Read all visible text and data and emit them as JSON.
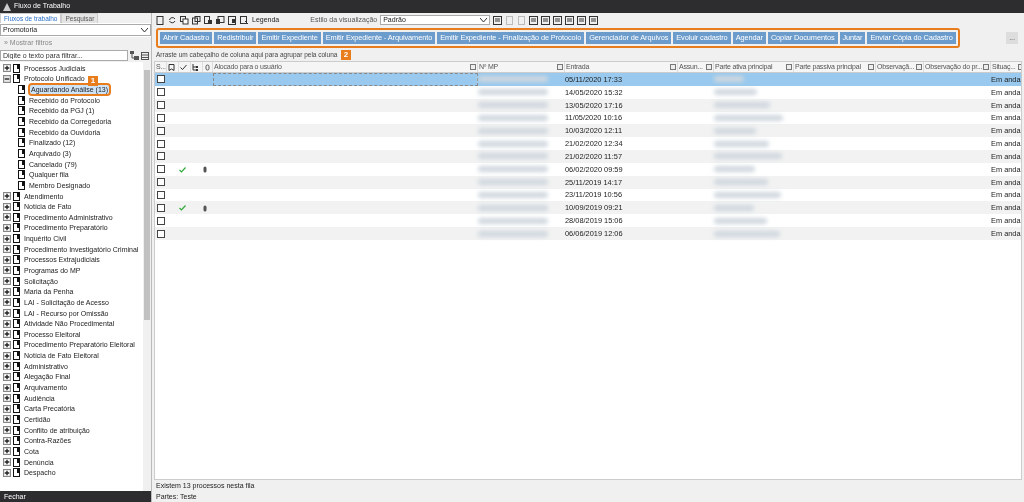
{
  "window": {
    "title": "Fluxo de Trabalho"
  },
  "left_tabs": [
    {
      "label": "Fluxos de trabalho",
      "selected": true
    },
    {
      "label": "Pesquisar",
      "selected": false
    }
  ],
  "scope_select": {
    "value": "Promotoria"
  },
  "filters_toggle": {
    "label": "Mostrar filtros",
    "arrow": "»"
  },
  "filter_field": {
    "placeholder": "Digite o texto para filtrar..."
  },
  "tree": [
    {
      "label": "Processos Judiciais",
      "expanded": false,
      "selected": false
    },
    {
      "label": "Protocolo Unificado",
      "expanded": true,
      "selected": false,
      "children": [
        {
          "label": "Aguardando Análise (13)",
          "selected": true,
          "callout": "1"
        },
        {
          "label": "Recebido do Protocolo",
          "selected": false
        },
        {
          "label": "Recebido da PGJ (1)",
          "selected": false
        },
        {
          "label": "Recebido da Corregedoria",
          "selected": false
        },
        {
          "label": "Recebido da Ouvidoria",
          "selected": false
        },
        {
          "label": "Finalizado (12)",
          "selected": false
        },
        {
          "label": "Arquivado (3)",
          "selected": false
        },
        {
          "label": "Cancelado (79)",
          "selected": false
        },
        {
          "label": "Qualquer fila",
          "selected": false
        },
        {
          "label": "Membro Designado",
          "selected": false
        }
      ]
    },
    {
      "label": "Atendimento",
      "expanded": false,
      "selected": false
    },
    {
      "label": "Notícia de Fato",
      "expanded": false,
      "selected": false
    },
    {
      "label": "Procedimento Administrativo",
      "expanded": false,
      "selected": false
    },
    {
      "label": "Procedimento Preparatório",
      "expanded": false,
      "selected": false
    },
    {
      "label": "Inquérito Civil",
      "expanded": false,
      "selected": false
    },
    {
      "label": "Procedimento Investigatório Criminal",
      "expanded": false,
      "selected": false
    },
    {
      "label": "Processos Extrajudiciais",
      "expanded": false,
      "selected": false
    },
    {
      "label": "Programas do MP",
      "expanded": false,
      "selected": false
    },
    {
      "label": "Solicitação",
      "expanded": false,
      "selected": false
    },
    {
      "label": "Maria da Penha",
      "expanded": false,
      "selected": false
    },
    {
      "label": "LAI - Solicitação de Acesso",
      "expanded": false,
      "selected": false
    },
    {
      "label": "LAI - Recurso por Omissão",
      "expanded": false,
      "selected": false
    },
    {
      "label": "Atividade Não Procedimental",
      "expanded": false,
      "selected": false
    },
    {
      "label": "Processo Eleitoral",
      "expanded": false,
      "selected": false
    },
    {
      "label": "Procedimento Preparatório Eleitoral",
      "expanded": false,
      "selected": false
    },
    {
      "label": "Notícia de Fato Eleitoral",
      "expanded": false,
      "selected": false
    },
    {
      "label": "Administrativo",
      "expanded": false,
      "selected": false
    },
    {
      "label": "Alegação Final",
      "expanded": false,
      "selected": false
    },
    {
      "label": "Arquivamento",
      "expanded": false,
      "selected": false
    },
    {
      "label": "Audiência",
      "expanded": false,
      "selected": false
    },
    {
      "label": "Carta Precatória",
      "expanded": false,
      "selected": false
    },
    {
      "label": "Certidão",
      "expanded": false,
      "selected": false
    },
    {
      "label": "Conflito de atribuição",
      "expanded": false,
      "selected": false
    },
    {
      "label": "Contra-Razões",
      "expanded": false,
      "selected": false
    },
    {
      "label": "Cota",
      "expanded": false,
      "selected": false
    },
    {
      "label": "Denúncia",
      "expanded": false,
      "selected": false
    },
    {
      "label": "Despacho",
      "expanded": false,
      "selected": false
    }
  ],
  "close_button": "Fechar",
  "toolbar": {
    "legend": "Legenda",
    "view_style_label": "Estilo da visualização",
    "view_style_value": "Padrão"
  },
  "actions": {
    "callout": "2",
    "buttons": [
      "Abrir Cadastro",
      "Redistribuir",
      "Emitir Expediente",
      "Emitir Expediente - Arquivamento",
      "Emitir Expediente - Finalização de Protocolo",
      "Gerenciador de Arquivos",
      "Evoluir cadastro",
      "Agendar",
      "Copiar Documentos",
      "Juntar",
      "Enviar Cópia do Cadastro"
    ],
    "more": "..."
  },
  "group_hint": "Arraste um cabeçalho de coluna aqui para agrupar pela coluna",
  "table": {
    "columns": [
      "S...",
      "Alocado para o usuário",
      "Nº MP",
      "Entrada",
      "Assun...",
      "Parte ativa principal",
      "Parte passiva principal",
      "Observaçã...",
      "Observação do pr...",
      "Situaç..."
    ],
    "rows": [
      {
        "entrada": "05/11/2020 17:33",
        "situacao": "Em anda",
        "selected": true,
        "done": false,
        "attachment": false
      },
      {
        "entrada": "14/05/2020 15:32",
        "situacao": "Em anda",
        "selected": false,
        "done": false,
        "attachment": false
      },
      {
        "entrada": "13/05/2020 17:16",
        "situacao": "Em anda",
        "selected": false,
        "done": false,
        "attachment": false
      },
      {
        "entrada": "11/05/2020 10:16",
        "situacao": "Em anda",
        "selected": false,
        "done": false,
        "attachment": false
      },
      {
        "entrada": "10/03/2020 12:11",
        "situacao": "Em anda",
        "selected": false,
        "done": false,
        "attachment": false
      },
      {
        "entrada": "21/02/2020 12:34",
        "situacao": "Em anda",
        "selected": false,
        "done": false,
        "attachment": false
      },
      {
        "entrada": "21/02/2020 11:57",
        "situacao": "Em anda",
        "selected": false,
        "done": false,
        "attachment": false
      },
      {
        "entrada": "06/02/2020 09:59",
        "situacao": "Em anda",
        "selected": false,
        "done": true,
        "attachment": true
      },
      {
        "entrada": "25/11/2019 14:17",
        "situacao": "Em anda",
        "selected": false,
        "done": false,
        "attachment": false
      },
      {
        "entrada": "23/11/2019 10:56",
        "situacao": "Em anda",
        "selected": false,
        "done": false,
        "attachment": false
      },
      {
        "entrada": "10/09/2019 09:21",
        "situacao": "Em anda",
        "selected": false,
        "done": true,
        "attachment": true
      },
      {
        "entrada": "28/08/2019 15:06",
        "situacao": "Em anda",
        "selected": false,
        "done": false,
        "attachment": false
      },
      {
        "entrada": "06/06/2019 12:06",
        "situacao": "Em anda",
        "selected": false,
        "done": false,
        "attachment": false
      }
    ]
  },
  "status": {
    "count": "Existem 13 processos nesta fila",
    "parties": "Partes: Teste"
  }
}
